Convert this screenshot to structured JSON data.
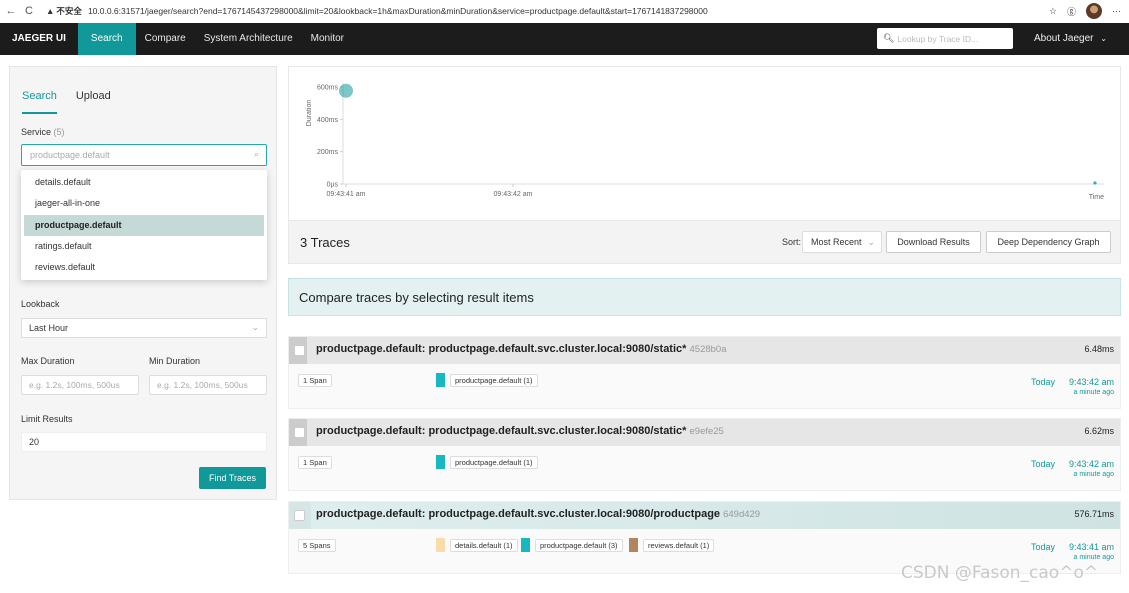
{
  "browser": {
    "back": "←",
    "reload": "C",
    "insecure_label": "不安全",
    "url": "10.0.0.6:31571/jaeger/search?end=1767145437298000&limit=20&lookback=1h&maxDuration&minDuration&service=productpage.default&start=1767141837298000"
  },
  "nav": {
    "brand": "JAEGER UI",
    "items": [
      "Search",
      "Compare",
      "System Architecture",
      "Monitor"
    ],
    "lookup_placeholder": "Lookup by Trace ID...",
    "about": "About Jaeger"
  },
  "left": {
    "tab_search": "Search",
    "tab_upload": "Upload",
    "service_label": "Service",
    "service_count": "(5)",
    "service_value": "productpage.default",
    "service_options": [
      "details.default",
      "jaeger-all-in-one",
      "productpage.default",
      "ratings.default",
      "reviews.default"
    ],
    "lookback_label": "Lookback",
    "lookback_value": "Last Hour",
    "max_duration_label": "Max Duration",
    "min_duration_label": "Min Duration",
    "duration_placeholder": "e.g. 1.2s, 100ms, 500us",
    "limit_label": "Limit Results",
    "limit_value": "20",
    "find_button": "Find Traces"
  },
  "chart_data": {
    "type": "scatter",
    "ylabel": "Duration",
    "xlabel": "Time",
    "y_ticks": [
      "600ms",
      "400ms",
      "200ms",
      "0µs"
    ],
    "x_ticks": [
      "09:43:41 am",
      "09:43:42 am"
    ],
    "points": [
      {
        "x": "09:43:41 am",
        "y_ms": 576.71
      },
      {
        "x": "09:43:42 am",
        "y_ms": 6.48
      },
      {
        "x": "09:43:42 am",
        "y_ms": 6.62
      }
    ],
    "ylim_ms": [
      0,
      600
    ]
  },
  "results": {
    "title": "3 Traces",
    "sort_label": "Sort:",
    "sort_value": "Most Recent",
    "download": "Download Results",
    "ddg": "Deep Dependency Graph",
    "compare_text": "Compare traces by selecting result items"
  },
  "traces": [
    {
      "title": "productpage.default: productpage.default.svc.cluster.local:9080/static*",
      "id": "4528b0a",
      "duration": "6.48ms",
      "spans": "1 Span",
      "services": [
        {
          "label": "productpage.default (1)",
          "color": "#17b8be"
        }
      ],
      "day": "Today",
      "time": "9:43:42 am",
      "ago": "a minute ago"
    },
    {
      "title": "productpage.default: productpage.default.svc.cluster.local:9080/static*",
      "id": "e9efe25",
      "duration": "6.62ms",
      "spans": "1 Span",
      "services": [
        {
          "label": "productpage.default (1)",
          "color": "#17b8be"
        }
      ],
      "day": "Today",
      "time": "9:43:42 am",
      "ago": "a minute ago"
    },
    {
      "title": "productpage.default: productpage.default.svc.cluster.local:9080/productpage",
      "id": "649d429",
      "duration": "576.71ms",
      "spans": "5 Spans",
      "services": [
        {
          "label": "details.default (1)",
          "color": "#f8dcaa"
        },
        {
          "label": "productpage.default (3)",
          "color": "#17b8be"
        },
        {
          "label": "reviews.default (1)",
          "color": "#b0855f"
        }
      ],
      "day": "Today",
      "time": "9:43:41 am",
      "ago": "a minute ago"
    }
  ],
  "watermark": "CSDN @Fason_cao^o^"
}
